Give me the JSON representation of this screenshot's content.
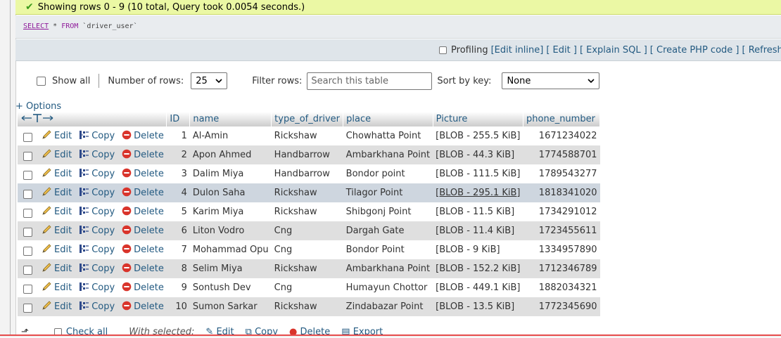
{
  "notice": {
    "text": "Showing rows 0 - 9 (10 total, Query took 0.0054 seconds.)"
  },
  "sql": {
    "select_kw": "SELECT",
    "middle": " * ",
    "from_kw": "FROM",
    "table": " `driver_user`"
  },
  "sql_ops": {
    "profiling": "Profiling",
    "links": [
      "[Edit inline]",
      "[ Edit ]",
      "[ Explain SQL ]",
      "[ Create PHP code ]",
      "[ Refresh ]"
    ]
  },
  "nav": {
    "show_all": "Show all",
    "rows_label": "Number of rows:",
    "rows_value": "25",
    "filter_label": "Filter rows:",
    "filter_placeholder": "Search this table",
    "sort_label": "Sort by key:",
    "sort_value": "None"
  },
  "options_link": "+ Options",
  "table": {
    "columns": [
      "ID",
      "name",
      "type_of_driver",
      "place",
      "Picture",
      "phone_number"
    ],
    "actions": {
      "edit": "Edit",
      "copy": "Copy",
      "delete": "Delete"
    },
    "rows": [
      {
        "id": "1",
        "name": "Al-Amin",
        "type": "Rickshaw",
        "place": "Chowhatta Point",
        "picture": "[BLOB - 255.5 KiB]",
        "phone": "1671234022"
      },
      {
        "id": "2",
        "name": "Apon Ahmed",
        "type": "Handbarrow",
        "place": "Ambarkhana Point",
        "picture": "[BLOB - 44.3 KiB]",
        "phone": "1774588701"
      },
      {
        "id": "3",
        "name": "Dalim Miya",
        "type": "Handbarrow",
        "place": "Bondor point",
        "picture": "[BLOB - 111.5 KiB]",
        "phone": "1789543277"
      },
      {
        "id": "4",
        "name": "Dulon Saha",
        "type": "Rickshaw",
        "place": "Tilagor Point",
        "picture": "[BLOB - 295.1 KiB]",
        "phone": "1818341020"
      },
      {
        "id": "5",
        "name": "Karim Miya",
        "type": "Rickshaw",
        "place": "Shibgonj Point",
        "picture": "[BLOB - 11.5 KiB]",
        "phone": "1734291012"
      },
      {
        "id": "6",
        "name": "Liton Vodro",
        "type": "Cng",
        "place": "Dargah Gate",
        "picture": "[BLOB - 11.4 KiB]",
        "phone": "1723455611"
      },
      {
        "id": "7",
        "name": "Mohammad Opu",
        "type": "Cng",
        "place": "Bondor Point",
        "picture": "[BLOB - 9 KiB]",
        "phone": "1334957890"
      },
      {
        "id": "8",
        "name": "Selim Miya",
        "type": "Rickshaw",
        "place": "Ambarkhana Point",
        "picture": "[BLOB - 152.2 KiB]",
        "phone": "1712346789"
      },
      {
        "id": "9",
        "name": "Sontush Dev",
        "type": "Cng",
        "place": "Humayun Chottor",
        "picture": "[BLOB - 449.1 KiB]",
        "phone": "1882034321"
      },
      {
        "id": "10",
        "name": "Sumon Sarkar",
        "type": "Rickshaw",
        "place": "Zindabazar Point",
        "picture": "[BLOB - 13.5 KiB]",
        "phone": "1772345690"
      }
    ]
  },
  "bottom": {
    "check_all": "Check all",
    "with_selected": "With selected:",
    "edit": "Edit",
    "copy": "Copy",
    "delete": "Delete",
    "export": "Export"
  },
  "colors": {
    "link": "#235a81",
    "notice_bg": "#ebf8a4",
    "row_alt": "#dfdfdf",
    "row_highlight": "#ced6df",
    "delete_red": "#d9342b"
  }
}
